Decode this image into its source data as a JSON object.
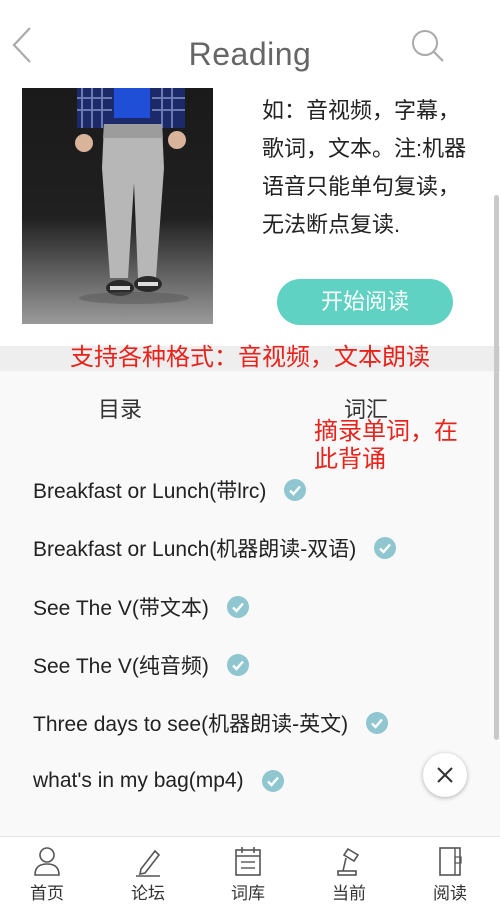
{
  "header": {
    "title": "Reading",
    "back_icon": "chevron-left-icon",
    "search_icon": "search-icon"
  },
  "book": {
    "description": "如：音视频，字幕，歌词，文本。注:机器语音只能单句复读，无法断点复读.",
    "start_label": "开始阅读"
  },
  "annotations": {
    "formats": "支持各种格式：音视频，文本朗读",
    "vocab": "摘录单词，在此背诵"
  },
  "tabs": {
    "toc": "目录",
    "vocab": "词汇"
  },
  "chapters": [
    {
      "title": "Breakfast or Lunch(带lrc)"
    },
    {
      "title": "Breakfast or Lunch(机器朗读-双语)"
    },
    {
      "title": "See The V(带文本)"
    },
    {
      "title": "See The V(纯音频)"
    },
    {
      "title": "Three days to see(机器朗读-英文)"
    },
    {
      "title": "what's in my bag(mp4)"
    }
  ],
  "tabbar": [
    {
      "label": "首页",
      "icon": "user-icon"
    },
    {
      "label": "论坛",
      "icon": "pen-icon"
    },
    {
      "label": "词库",
      "icon": "calendar-icon"
    },
    {
      "label": "当前",
      "icon": "lamp-icon"
    },
    {
      "label": "阅读",
      "icon": "book-icon"
    }
  ],
  "colors": {
    "accent": "#5fd2c3",
    "annotation_red": "#e8231c",
    "check": "#8fc6cf"
  }
}
